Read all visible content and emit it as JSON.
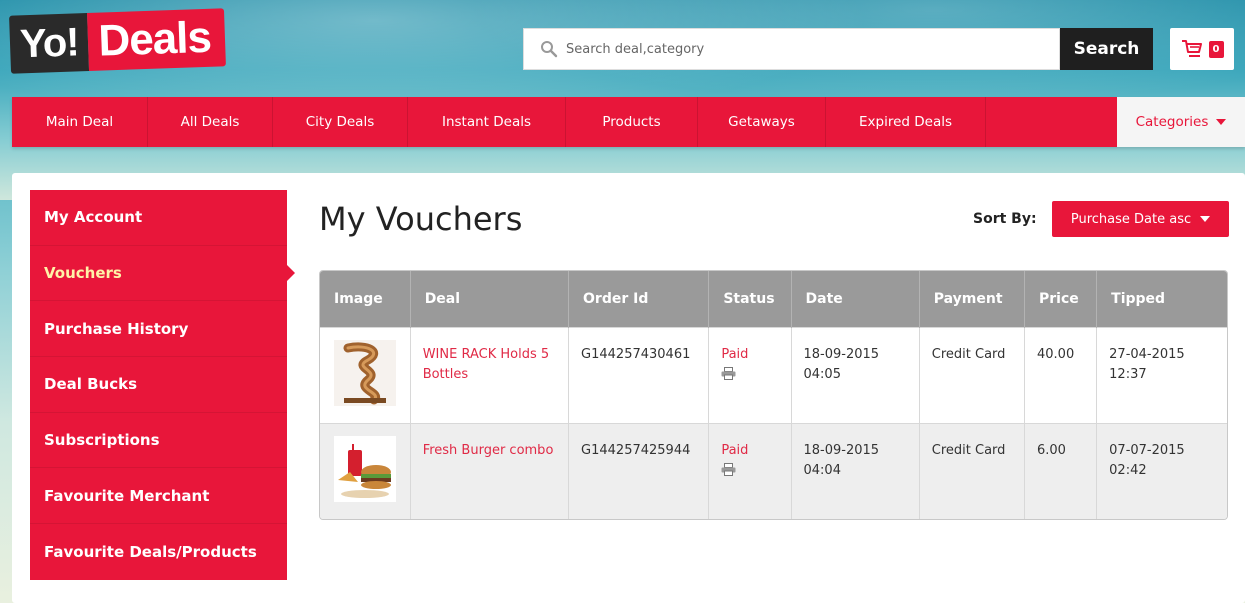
{
  "brand": {
    "logo_part1": "Yo!",
    "logo_part2": "Deals",
    "accent_color": "#e8163a"
  },
  "header": {
    "search_placeholder": "Search deal,category",
    "search_button": "Search",
    "cart_count": "0"
  },
  "nav": {
    "items": [
      {
        "label": "Main Deal"
      },
      {
        "label": "All Deals"
      },
      {
        "label": "City Deals"
      },
      {
        "label": "Instant Deals"
      },
      {
        "label": "Products"
      },
      {
        "label": "Getaways"
      },
      {
        "label": "Expired Deals"
      }
    ],
    "categories_label": "Categories"
  },
  "sidebar": {
    "items": [
      {
        "label": "My Account"
      },
      {
        "label": "Vouchers",
        "active": true
      },
      {
        "label": "Purchase History"
      },
      {
        "label": "Deal Bucks"
      },
      {
        "label": "Subscriptions"
      },
      {
        "label": "Favourite Merchant"
      },
      {
        "label": "Favourite Deals/Products"
      }
    ]
  },
  "main": {
    "title": "My Vouchers",
    "sort_label": "Sort By:",
    "sort_value": "Purchase Date asc"
  },
  "table": {
    "headers": [
      "Image",
      "Deal",
      "Order Id",
      "Status",
      "Date",
      "Payment",
      "Price",
      "Tipped"
    ],
    "rows": [
      {
        "image_icon": "wine-rack-image",
        "deal": "WINE RACK Holds 5 Bottles",
        "order_id": "G144257430461",
        "status": "Paid",
        "date": "18-09-2015 04:05",
        "payment": "Credit Card",
        "price": "40.00",
        "tipped": "27-04-2015 12:37"
      },
      {
        "image_icon": "burger-combo-image",
        "deal": "Fresh Burger combo",
        "order_id": "G144257425944",
        "status": "Paid",
        "date": "18-09-2015 04:04",
        "payment": "Credit Card",
        "price": "6.00",
        "tipped": "07-07-2015 02:42"
      }
    ]
  }
}
